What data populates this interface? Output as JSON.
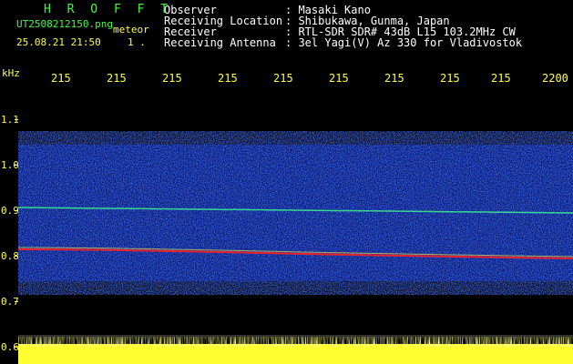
{
  "header": {
    "title": "H R O F F T",
    "filename": "UT2508212150.png",
    "type": "meteor",
    "datetime": "25.08.21 21:50",
    "extra": "1 ."
  },
  "info": {
    "labels": [
      "Observer",
      "Receiving Location",
      "Receiver",
      "Receiving Antenna"
    ],
    "values": [
      ": Masaki Kano",
      ": Shibukawa, Gunma, Japan",
      ": RTL-SDR SDR# 43dB L15 103.2MHz CW",
      ": 3el Yagi(V) Az 330 for Vladivostok"
    ]
  },
  "axes": {
    "yunit": "kHz",
    "yticks": [
      "1.1",
      "1.0",
      "0.9",
      "0.8",
      "0.7",
      "0.6"
    ],
    "xticks": [
      "215",
      "215",
      "215",
      "215",
      "215",
      "215",
      "215",
      "215",
      "215",
      "2200"
    ]
  },
  "colors": {
    "label_yellow": "#ffff40",
    "title_green": "#3cff3c",
    "noise_blue": "#1030ff",
    "echo_red": "#ff2020"
  }
}
